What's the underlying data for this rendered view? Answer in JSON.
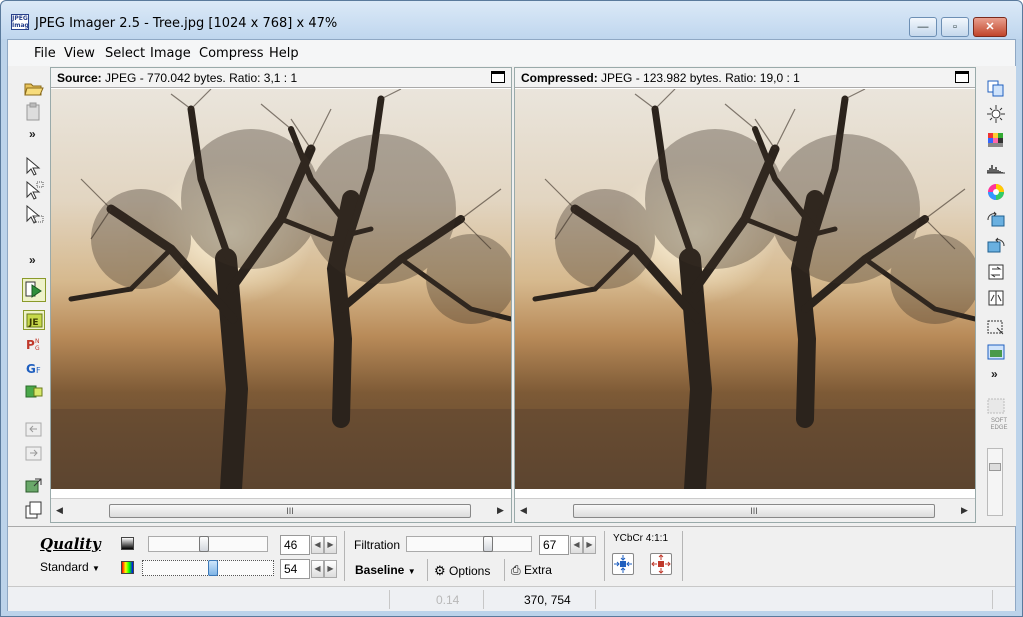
{
  "window": {
    "title": "JPEG Imager 2.5 - Tree.jpg [1024 x 768] x 47%",
    "icon_text": "JPEG Image",
    "buttons": {
      "minimize": "—",
      "maximize": "▫",
      "close": "✕"
    }
  },
  "menu": {
    "items": [
      "File",
      "View",
      "Select",
      "Image",
      "Compress",
      "Help"
    ]
  },
  "left_toolbar": {
    "icons": [
      "open-folder-icon",
      "paste-icon",
      "select-arrow-icon",
      "select-add-icon",
      "select-subtract-icon",
      "play-compare-icon",
      "jpeg-format-icon",
      "png-format-icon",
      "gif-format-icon",
      "bmp-format-icon",
      "arrow-left-icon",
      "arrow-right-icon",
      "export-icon",
      "copy-pages-icon"
    ]
  },
  "right_toolbar": {
    "icons": [
      "copy-icon",
      "brightness-icon",
      "palette-grid-icon",
      "histogram-icon",
      "color-wheel-icon",
      "rotate-left-icon",
      "rotate-right-icon",
      "flip-icon",
      "mirror-icon",
      "crop-select-icon",
      "view-image-icon",
      "soft-edge-icon",
      "slider-icon"
    ],
    "soft_edge_label": "SOFT\nEDGE"
  },
  "source_pane": {
    "label": "Source:",
    "info": "JPEG - 770.042 bytes. Ratio: 3,1 : 1",
    "scroll_thumb": "III"
  },
  "compressed_pane": {
    "label": "Compressed:",
    "info": "JPEG - 123.982 bytes. Ratio: 19,0 : 1",
    "scroll_thumb": "III"
  },
  "quality": {
    "label": "Quality",
    "preset": "Standard",
    "luma_value": "46",
    "luma_level": 0.46,
    "chroma_value": "54",
    "chroma_level": 0.54
  },
  "filtration": {
    "label": "Filtration",
    "value": "67",
    "level": 0.67,
    "mode": "Baseline",
    "options_label": "Options",
    "extra_label": "Extra"
  },
  "ycbcr": {
    "label": "YCbCr 4:1:1"
  },
  "status": {
    "zoom": "0.14",
    "coords": "370, 754"
  },
  "colors": {
    "accent": "#3b78b8",
    "close": "#c1452a",
    "title_bg": "#bfd6ee"
  }
}
